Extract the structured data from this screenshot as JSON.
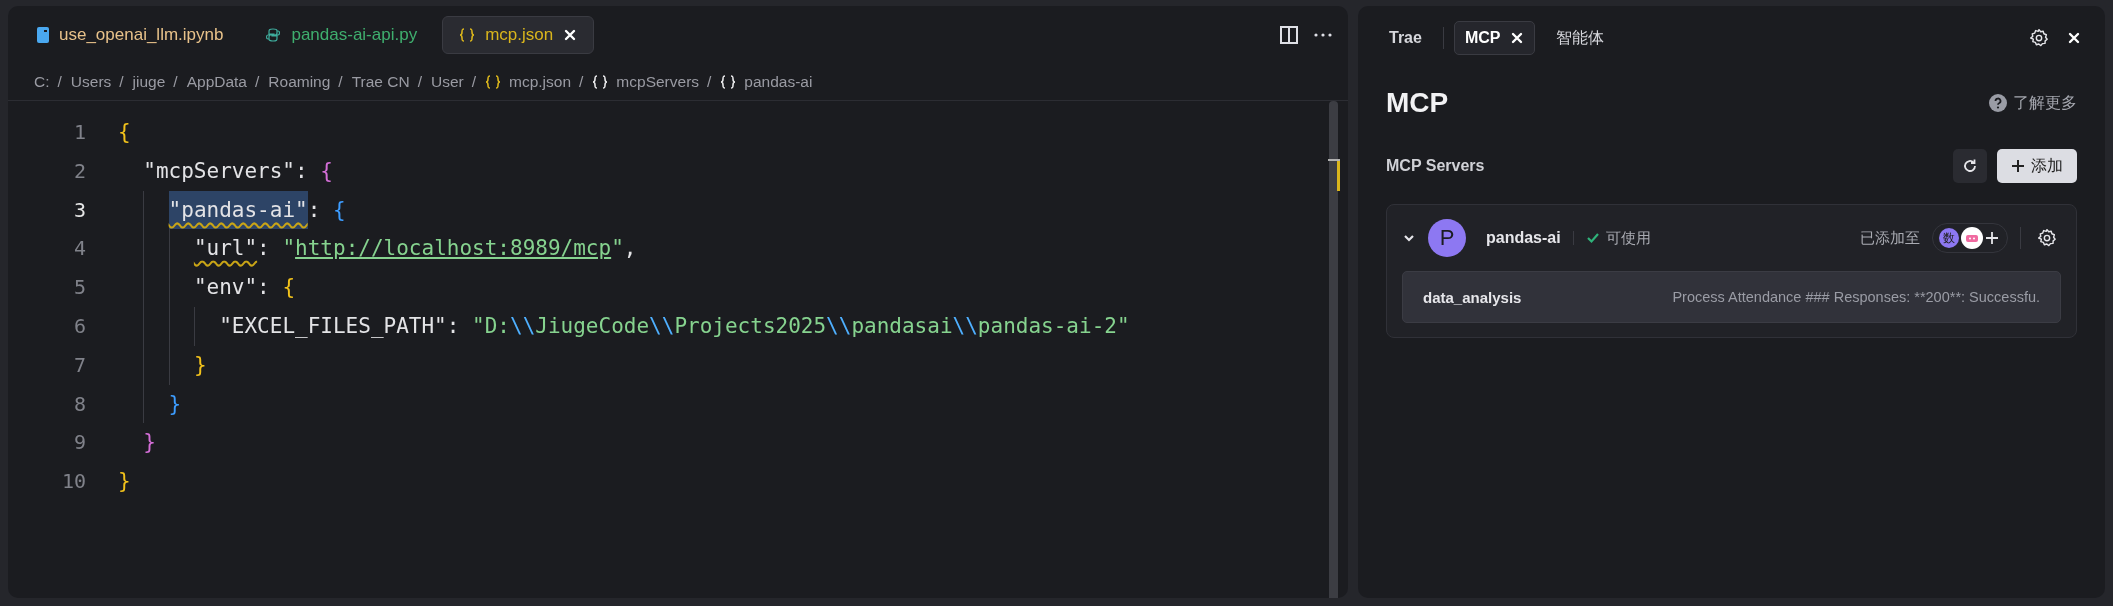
{
  "editor": {
    "tabs": [
      {
        "label": "use_openai_llm.ipynb",
        "kind": "notebook",
        "color": "#e8c28a",
        "selected": false
      },
      {
        "label": "pandas-ai-api.py",
        "kind": "python",
        "color": "#3fae6e",
        "selected": false
      },
      {
        "label": "mcp.json",
        "kind": "braces",
        "color": "#d9b51c",
        "selected": true
      }
    ],
    "breadcrumb": [
      {
        "label": "C:",
        "sep": "/"
      },
      {
        "label": "Users",
        "sep": "/"
      },
      {
        "label": "jiuge",
        "sep": "/"
      },
      {
        "label": "AppData",
        "sep": "/"
      },
      {
        "label": "Roaming",
        "sep": "/"
      },
      {
        "label": "Trae CN",
        "sep": "/"
      },
      {
        "label": "User",
        "sep": "/"
      },
      {
        "label": "mcp.json",
        "kind": "braces-file",
        "sep": "/"
      },
      {
        "label": "mcpServers",
        "kind": "braces",
        "sep": "/"
      },
      {
        "label": "pandas-ai",
        "kind": "braces"
      }
    ],
    "lines": [
      {
        "number": "1",
        "active": false,
        "tokens": [
          {
            "text": "{",
            "kind": "brace-gold"
          }
        ]
      },
      {
        "number": "2",
        "active": false,
        "tokens": [
          {
            "text": "\"mcpServers\"",
            "kind": "key"
          },
          {
            "text": ": ",
            "kind": "punct"
          },
          {
            "text": "{",
            "kind": "brace-pink"
          }
        ]
      },
      {
        "number": "3",
        "active": true,
        "tokens": [
          {
            "text": "\"pandas-ai\"",
            "kind": "key-selected"
          },
          {
            "text": ": ",
            "kind": "punct"
          },
          {
            "text": "{",
            "kind": "brace-blue"
          }
        ]
      },
      {
        "number": "4",
        "active": false,
        "tokens": [
          {
            "text": "\"url\"",
            "kind": "key-warned"
          },
          {
            "text": ": ",
            "kind": "punct"
          },
          {
            "text": "\"",
            "kind": "string"
          },
          {
            "text": "http://localhost:8989/mcp",
            "kind": "link"
          },
          {
            "text": "\"",
            "kind": "string"
          },
          {
            "text": ",",
            "kind": "punct"
          }
        ]
      },
      {
        "number": "5",
        "active": false,
        "tokens": [
          {
            "text": "\"env\"",
            "kind": "key"
          },
          {
            "text": ": ",
            "kind": "punct"
          },
          {
            "text": "{",
            "kind": "brace-gold"
          }
        ]
      },
      {
        "number": "6",
        "active": false,
        "tokens": [
          {
            "text": "\"EXCEL_FILES_PATH\"",
            "kind": "key"
          },
          {
            "text": ": ",
            "kind": "punct"
          },
          {
            "text": "\"D:",
            "kind": "string"
          },
          {
            "text": "\\\\",
            "kind": "escape"
          },
          {
            "text": "JiugeCode",
            "kind": "string"
          },
          {
            "text": "\\\\",
            "kind": "escape"
          },
          {
            "text": "Projects2025",
            "kind": "string"
          },
          {
            "text": "\\\\",
            "kind": "escape"
          },
          {
            "text": "pandasai",
            "kind": "string"
          },
          {
            "text": "\\\\",
            "kind": "escape"
          },
          {
            "text": "pandas-ai-2\"",
            "kind": "string"
          }
        ]
      },
      {
        "number": "7",
        "active": false,
        "tokens": [
          {
            "text": "}",
            "kind": "brace-gold"
          }
        ]
      },
      {
        "number": "8",
        "active": false,
        "tokens": [
          {
            "text": "}",
            "kind": "brace-blue"
          }
        ]
      },
      {
        "number": "9",
        "active": false,
        "tokens": [
          {
            "text": "}",
            "kind": "brace-pink"
          }
        ]
      },
      {
        "number": "10",
        "active": false,
        "tokens": [
          {
            "text": "}",
            "kind": "brace-gold"
          }
        ]
      }
    ]
  },
  "panel": {
    "tabs": [
      {
        "label": "Trae",
        "selected": false
      },
      {
        "label": "MCP",
        "selected": true
      },
      {
        "label": "智能体",
        "selected": false
      }
    ],
    "title": "MCP",
    "help_link": "了解更多",
    "section_title": "MCP Servers",
    "add_button": "添加",
    "servers": [
      {
        "avatar": "P",
        "name": "pandas-ai",
        "status": "可使用",
        "expanded": true,
        "added_to_label": "已添加至",
        "agent_avatar": "数",
        "tools": [
          {
            "name": "data_analysis",
            "description": "Process Attendance ### Responses: **200**: Successfu."
          }
        ]
      }
    ]
  }
}
